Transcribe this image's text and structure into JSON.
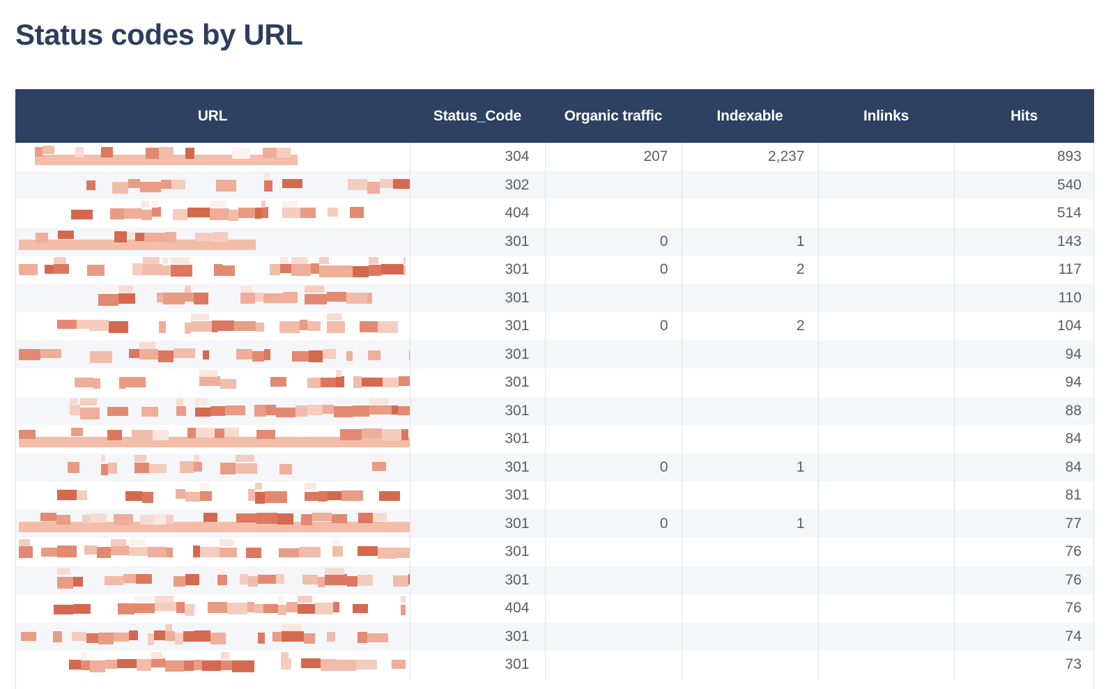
{
  "page": {
    "title": "Status codes by URL",
    "title_color": "#2b3e5e",
    "header_bg": "#2e4163",
    "header_text_color": "#ffffff",
    "row_alt_bg": "#f4f6f9",
    "cell_text_color": "#5d5d5d",
    "redaction_color": "#d9694d"
  },
  "table": {
    "columns": [
      {
        "key": "url",
        "label": "URL",
        "align": "center"
      },
      {
        "key": "status_code",
        "label": "Status_Code",
        "align": "right"
      },
      {
        "key": "organic",
        "label": "Organic traffic",
        "align": "right"
      },
      {
        "key": "indexable",
        "label": "Indexable",
        "align": "right"
      },
      {
        "key": "inlinks",
        "label": "Inlinks",
        "align": "right"
      },
      {
        "key": "hits",
        "label": "Hits",
        "align": "right"
      }
    ],
    "rows": [
      {
        "url": "",
        "status_code": "304",
        "organic": "207",
        "indexable": "2,237",
        "inlinks": "",
        "hits": "893"
      },
      {
        "url": "",
        "status_code": "302",
        "organic": "",
        "indexable": "",
        "inlinks": "",
        "hits": "540"
      },
      {
        "url": "",
        "status_code": "404",
        "organic": "",
        "indexable": "",
        "inlinks": "",
        "hits": "514"
      },
      {
        "url": "",
        "status_code": "301",
        "organic": "0",
        "indexable": "1",
        "inlinks": "",
        "hits": "143"
      },
      {
        "url": "",
        "status_code": "301",
        "organic": "0",
        "indexable": "2",
        "inlinks": "",
        "hits": "117"
      },
      {
        "url": "",
        "status_code": "301",
        "organic": "",
        "indexable": "",
        "inlinks": "",
        "hits": "110"
      },
      {
        "url": "",
        "status_code": "301",
        "organic": "0",
        "indexable": "2",
        "inlinks": "",
        "hits": "104"
      },
      {
        "url": "",
        "status_code": "301",
        "organic": "",
        "indexable": "",
        "inlinks": "",
        "hits": "94"
      },
      {
        "url": "",
        "status_code": "301",
        "organic": "",
        "indexable": "",
        "inlinks": "",
        "hits": "94"
      },
      {
        "url": "",
        "status_code": "301",
        "organic": "",
        "indexable": "",
        "inlinks": "",
        "hits": "88"
      },
      {
        "url": "",
        "status_code": "301",
        "organic": "",
        "indexable": "",
        "inlinks": "",
        "hits": "84"
      },
      {
        "url": "",
        "status_code": "301",
        "organic": "0",
        "indexable": "1",
        "inlinks": "",
        "hits": "84"
      },
      {
        "url": "",
        "status_code": "301",
        "organic": "",
        "indexable": "",
        "inlinks": "",
        "hits": "81"
      },
      {
        "url": "",
        "status_code": "301",
        "organic": "0",
        "indexable": "1",
        "inlinks": "",
        "hits": "77"
      },
      {
        "url": "",
        "status_code": "301",
        "organic": "",
        "indexable": "",
        "inlinks": "",
        "hits": "76"
      },
      {
        "url": "",
        "status_code": "301",
        "organic": "",
        "indexable": "",
        "inlinks": "",
        "hits": "76"
      },
      {
        "url": "",
        "status_code": "404",
        "organic": "",
        "indexable": "",
        "inlinks": "",
        "hits": "76"
      },
      {
        "url": "",
        "status_code": "301",
        "organic": "",
        "indexable": "",
        "inlinks": "",
        "hits": "74"
      },
      {
        "url": "",
        "status_code": "301",
        "organic": "",
        "indexable": "",
        "inlinks": "",
        "hits": "73"
      }
    ],
    "url_column_state": "redacted"
  }
}
